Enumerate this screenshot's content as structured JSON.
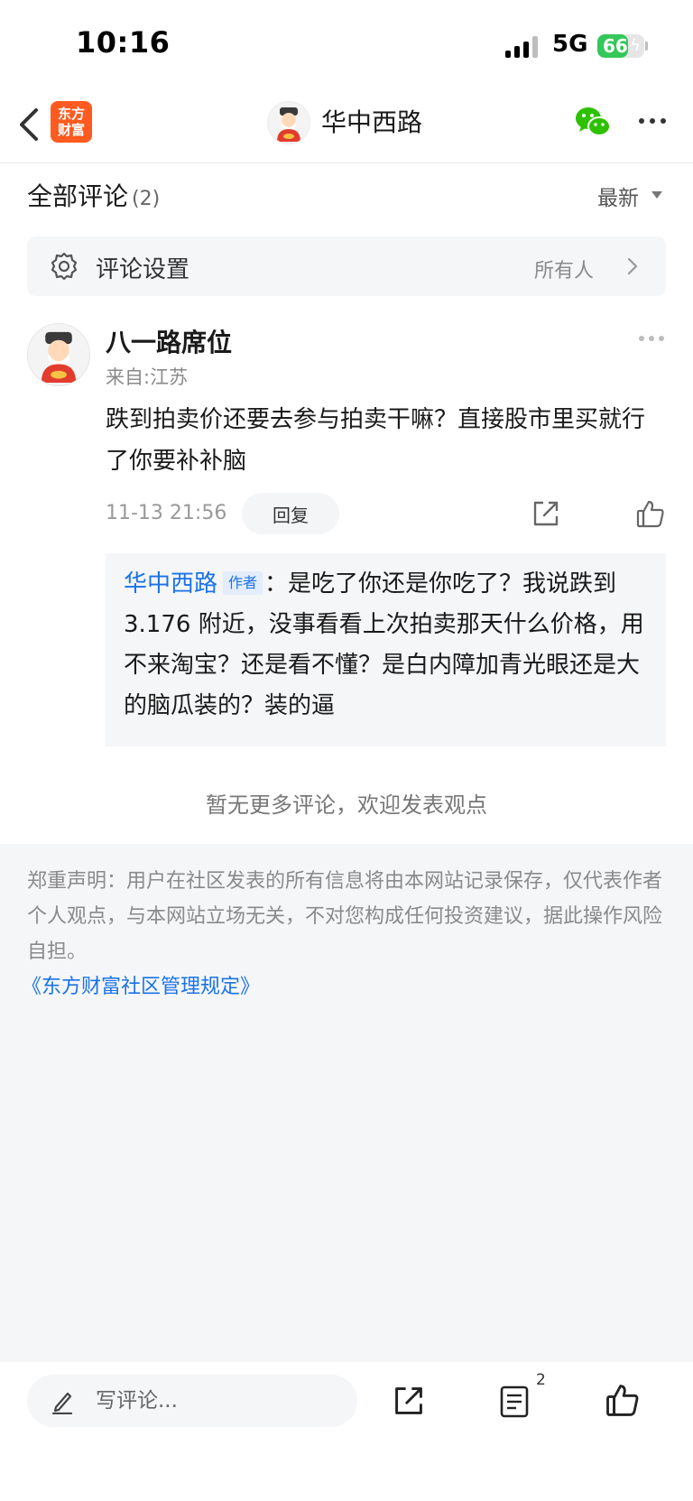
{
  "status_bar": {
    "time": "10:16",
    "network": "5G",
    "battery": "66",
    "battery_level": 0.66
  },
  "nav": {
    "logo_line1": "东方",
    "logo_line2": "财富",
    "title": "华中西路"
  },
  "comments_header": {
    "title": "全部评论",
    "count": "(2)",
    "sort": "最新"
  },
  "settings": {
    "label": "评论设置",
    "value": "所有人"
  },
  "comment": {
    "name": "八一路席位",
    "location": "来自:江苏",
    "text": "跌到拍卖价还要去参与拍卖干嘛？直接股市里买就行了你要补补脑",
    "time": "11-13 21:56",
    "reply_label": "回复"
  },
  "quote": {
    "author": "华中西路",
    "badge": "作者",
    "separator": "：",
    "text": "是吃了你还是你吃了？我说跌到 3.176 附近，没事看看上次拍卖那天什么价格，用不来淘宝？还是看不懂？是白内障加青光眼还是大的脑瓜装的？装的逼"
  },
  "no_more": "暂无更多评论，欢迎发表观点",
  "disclaimer": "郑重声明：用户在社区发表的所有信息将由本网站记录保存，仅代表作者个人观点，与本网站立场无关，不对您构成任何投资建议，据此操作风险自担。",
  "rules_link": "《东方财富社区管理规定》",
  "bottom_bar": {
    "input_placeholder": "写评论...",
    "comment_count": "2"
  },
  "colors": {
    "accent_blue": "#1a73e8",
    "brand_orange": "#ff5a1f",
    "wechat_green": "#2dc100",
    "battery_green": "#34c759"
  }
}
